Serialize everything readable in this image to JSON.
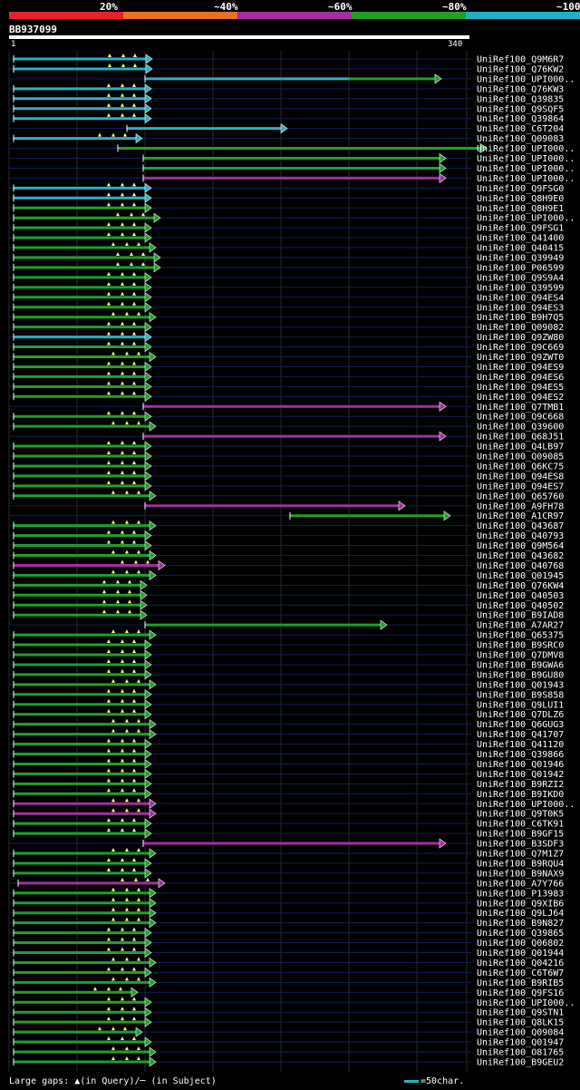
{
  "legend": {
    "labels": [
      "20%",
      "~40%",
      "~60%",
      "~80%",
      "~100%"
    ],
    "colors": [
      "#e8202c",
      "#e87020",
      "#a030a0",
      "#20a020",
      "#20b0c0"
    ]
  },
  "query": {
    "id": "BB937099",
    "start_label": "1",
    "end_label": "340"
  },
  "hits": [
    {
      "id": "UniRef100_Q9M6R7",
      "c": "cyan",
      "s": 5,
      "e": 151
    },
    {
      "id": "UniRef100_Q76KW2",
      "c": "cyan",
      "s": 5,
      "e": 151
    },
    {
      "id": "UniRef100_UPI000..",
      "c": "cyan",
      "s": 150,
      "e": 375,
      "tail": [
        375,
        470,
        "green"
      ]
    },
    {
      "id": "UniRef100_Q76KW3",
      "c": "cyan",
      "s": 5,
      "e": 150
    },
    {
      "id": "UniRef100_Q39835",
      "c": "cyan",
      "s": 5,
      "e": 150
    },
    {
      "id": "UniRef100_Q9SQF5",
      "c": "cyan",
      "s": 5,
      "e": 150
    },
    {
      "id": "UniRef100_Q39864",
      "c": "cyan",
      "s": 5,
      "e": 150
    },
    {
      "id": "UniRef100_C6T204",
      "c": "cyan",
      "s": 130,
      "e": 300
    },
    {
      "id": "UniRef100_Q09083",
      "c": "cyan",
      "s": 5,
      "e": 140
    },
    {
      "id": "UniRef100_UPI000..",
      "c": "green",
      "s": 120,
      "e": 520
    },
    {
      "id": "UniRef100_UPI000..",
      "c": "green",
      "s": 148,
      "e": 475
    },
    {
      "id": "UniRef100_UPI000..",
      "c": "green",
      "s": 148,
      "e": 475
    },
    {
      "id": "UniRef100_UPI000..",
      "c": "purple",
      "s": 148,
      "e": 475
    },
    {
      "id": "UniRef100_Q9FSG0",
      "c": "cyan",
      "s": 5,
      "e": 150
    },
    {
      "id": "UniRef100_Q8H9E0",
      "c": "cyan",
      "s": 5,
      "e": 150
    },
    {
      "id": "UniRef100_Q8H9E1",
      "c": "green",
      "s": 5,
      "e": 150
    },
    {
      "id": "UniRef100_UPI000..",
      "c": "green",
      "s": 5,
      "e": 160
    },
    {
      "id": "UniRef100_Q9FSG1",
      "c": "green",
      "s": 5,
      "e": 150
    },
    {
      "id": "UniRef100_Q41400",
      "c": "green",
      "s": 5,
      "e": 150
    },
    {
      "id": "UniRef100_Q40415",
      "c": "green",
      "s": 5,
      "e": 155
    },
    {
      "id": "UniRef100_Q39949",
      "c": "green",
      "s": 5,
      "e": 160
    },
    {
      "id": "UniRef100_P06599",
      "c": "green",
      "s": 5,
      "e": 160
    },
    {
      "id": "UniRef100_Q9S9A4",
      "c": "green",
      "s": 5,
      "e": 150
    },
    {
      "id": "UniRef100_Q39599",
      "c": "green",
      "s": 5,
      "e": 150
    },
    {
      "id": "UniRef100_Q94ES4",
      "c": "green",
      "s": 5,
      "e": 150
    },
    {
      "id": "UniRef100_Q94ES3",
      "c": "green",
      "s": 5,
      "e": 150
    },
    {
      "id": "UniRef100_B9H7Q5",
      "c": "green",
      "s": 5,
      "e": 155
    },
    {
      "id": "UniRef100_Q09082",
      "c": "green",
      "s": 5,
      "e": 150
    },
    {
      "id": "UniRef100_Q9ZW80",
      "c": "cyan",
      "s": 5,
      "e": 150
    },
    {
      "id": "UniRef100_Q9C669",
      "c": "green",
      "s": 5,
      "e": 150
    },
    {
      "id": "UniRef100_Q9ZWT0",
      "c": "green",
      "s": 5,
      "e": 155
    },
    {
      "id": "UniRef100_Q94ES9",
      "c": "green",
      "s": 5,
      "e": 150
    },
    {
      "id": "UniRef100_Q94ES6",
      "c": "green",
      "s": 5,
      "e": 150
    },
    {
      "id": "UniRef100_Q94ES5",
      "c": "green",
      "s": 5,
      "e": 150
    },
    {
      "id": "UniRef100_Q94ES2",
      "c": "green",
      "s": 5,
      "e": 150
    },
    {
      "id": "UniRef100_Q7TMB1",
      "c": "purple",
      "s": 148,
      "e": 475
    },
    {
      "id": "UniRef100_Q9C668",
      "c": "green",
      "s": 5,
      "e": 150
    },
    {
      "id": "UniRef100_Q39600",
      "c": "green",
      "s": 5,
      "e": 155
    },
    {
      "id": "UniRef100_Q68J51",
      "c": "purple",
      "s": 148,
      "e": 475
    },
    {
      "id": "UniRef100_Q4LB97",
      "c": "green",
      "s": 5,
      "e": 150
    },
    {
      "id": "UniRef100_Q09085",
      "c": "green",
      "s": 5,
      "e": 150
    },
    {
      "id": "UniRef100_Q6KC75",
      "c": "green",
      "s": 5,
      "e": 150
    },
    {
      "id": "UniRef100_Q94ES8",
      "c": "green",
      "s": 5,
      "e": 150
    },
    {
      "id": "UniRef100_Q94ES7",
      "c": "green",
      "s": 5,
      "e": 150
    },
    {
      "id": "UniRef100_Q65760",
      "c": "green",
      "s": 5,
      "e": 155
    },
    {
      "id": "UniRef100_A9FH78",
      "c": "purple",
      "s": 150,
      "e": 430
    },
    {
      "id": "UniRef100_A1CR97",
      "c": "green",
      "s": 310,
      "e": 480
    },
    {
      "id": "UniRef100_Q43687",
      "c": "green",
      "s": 5,
      "e": 155
    },
    {
      "id": "UniRef100_Q40793",
      "c": "green",
      "s": 5,
      "e": 150
    },
    {
      "id": "UniRef100_Q9M564",
      "c": "green",
      "s": 5,
      "e": 150
    },
    {
      "id": "UniRef100_Q43682",
      "c": "green",
      "s": 5,
      "e": 155
    },
    {
      "id": "UniRef100_Q40768",
      "c": "purple",
      "s": 5,
      "e": 165
    },
    {
      "id": "UniRef100_Q01945",
      "c": "green",
      "s": 5,
      "e": 155
    },
    {
      "id": "UniRef100_Q76KW4",
      "c": "green",
      "s": 5,
      "e": 145
    },
    {
      "id": "UniRef100_Q40503",
      "c": "green",
      "s": 5,
      "e": 145
    },
    {
      "id": "UniRef100_Q40502",
      "c": "green",
      "s": 5,
      "e": 145
    },
    {
      "id": "UniRef100_B9IAD8",
      "c": "green",
      "s": 5,
      "e": 145
    },
    {
      "id": "UniRef100_A7AR27",
      "c": "green",
      "s": 150,
      "e": 410
    },
    {
      "id": "UniRef100_Q65375",
      "c": "green",
      "s": 5,
      "e": 155
    },
    {
      "id": "UniRef100_B9SRC0",
      "c": "green",
      "s": 5,
      "e": 150
    },
    {
      "id": "UniRef100_Q7DMV8",
      "c": "green",
      "s": 5,
      "e": 150
    },
    {
      "id": "UniRef100_B9GWA6",
      "c": "green",
      "s": 5,
      "e": 150
    },
    {
      "id": "UniRef100_B9GU80",
      "c": "green",
      "s": 5,
      "e": 150
    },
    {
      "id": "UniRef100_Q01943",
      "c": "green",
      "s": 5,
      "e": 155
    },
    {
      "id": "UniRef100_B9S858",
      "c": "green",
      "s": 5,
      "e": 150
    },
    {
      "id": "UniRef100_Q9LUI1",
      "c": "green",
      "s": 5,
      "e": 150
    },
    {
      "id": "UniRef100_Q7DLZ6",
      "c": "green",
      "s": 5,
      "e": 150
    },
    {
      "id": "UniRef100_Q6GUG3",
      "c": "green",
      "s": 5,
      "e": 155
    },
    {
      "id": "UniRef100_Q41707",
      "c": "green",
      "s": 5,
      "e": 155
    },
    {
      "id": "UniRef100_Q41120",
      "c": "green",
      "s": 5,
      "e": 150
    },
    {
      "id": "UniRef100_Q39866",
      "c": "green",
      "s": 5,
      "e": 150
    },
    {
      "id": "UniRef100_Q01946",
      "c": "green",
      "s": 5,
      "e": 150
    },
    {
      "id": "UniRef100_Q01942",
      "c": "green",
      "s": 5,
      "e": 150
    },
    {
      "id": "UniRef100_B9RZI2",
      "c": "green",
      "s": 5,
      "e": 150
    },
    {
      "id": "UniRef100_B9IKD0",
      "c": "green",
      "s": 5,
      "e": 150
    },
    {
      "id": "UniRef100_UPI000..",
      "c": "purple",
      "s": 5,
      "e": 155
    },
    {
      "id": "UniRef100_Q9T0K5",
      "c": "purple",
      "s": 5,
      "e": 155
    },
    {
      "id": "UniRef100_C6TK91",
      "c": "green",
      "s": 5,
      "e": 150
    },
    {
      "id": "UniRef100_B9GF15",
      "c": "green",
      "s": 5,
      "e": 150
    },
    {
      "id": "UniRef100_B3SDF3",
      "c": "purple",
      "s": 148,
      "e": 475
    },
    {
      "id": "UniRef100_Q7M1Z7",
      "c": "green",
      "s": 5,
      "e": 155
    },
    {
      "id": "UniRef100_B9RQU4",
      "c": "green",
      "s": 5,
      "e": 150
    },
    {
      "id": "UniRef100_B9NAX9",
      "c": "green",
      "s": 5,
      "e": 150
    },
    {
      "id": "UniRef100_A7Y766",
      "c": "purple",
      "s": 10,
      "e": 165
    },
    {
      "id": "UniRef100_P13983",
      "c": "green",
      "s": 5,
      "e": 155
    },
    {
      "id": "UniRef100_Q9XIB6",
      "c": "green",
      "s": 5,
      "e": 155
    },
    {
      "id": "UniRef100_Q9LJ64",
      "c": "green",
      "s": 5,
      "e": 155
    },
    {
      "id": "UniRef100_B9N827",
      "c": "green",
      "s": 5,
      "e": 155
    },
    {
      "id": "UniRef100_Q39865",
      "c": "green",
      "s": 5,
      "e": 150
    },
    {
      "id": "UniRef100_Q06802",
      "c": "green",
      "s": 5,
      "e": 150
    },
    {
      "id": "UniRef100_Q01944",
      "c": "green",
      "s": 5,
      "e": 150
    },
    {
      "id": "UniRef100_Q04216",
      "c": "green",
      "s": 5,
      "e": 155
    },
    {
      "id": "UniRef100_C6T6W7",
      "c": "green",
      "s": 5,
      "e": 150
    },
    {
      "id": "UniRef100_B9RIB5",
      "c": "green",
      "s": 5,
      "e": 155
    },
    {
      "id": "UniRef100_Q9FS16",
      "c": "green",
      "s": 5,
      "e": 135
    },
    {
      "id": "UniRef100_UPI000..",
      "c": "green",
      "s": 5,
      "e": 150
    },
    {
      "id": "UniRef100_Q9STN1",
      "c": "green",
      "s": 5,
      "e": 150
    },
    {
      "id": "UniRef100_Q8LK15",
      "c": "green",
      "s": 5,
      "e": 150
    },
    {
      "id": "UniRef100_Q09084",
      "c": "green",
      "s": 5,
      "e": 140
    },
    {
      "id": "UniRef100_Q01947",
      "c": "green",
      "s": 5,
      "e": 150
    },
    {
      "id": "UniRef100_O81765",
      "c": "green",
      "s": 5,
      "e": 155
    },
    {
      "id": "UniRef100_B9GEU2",
      "c": "green",
      "s": 5,
      "e": 155
    }
  ],
  "footer": {
    "gaps_text": "Large gaps: ▲(in Query)/─ (in Subject)",
    "scale_text": "=50char."
  }
}
